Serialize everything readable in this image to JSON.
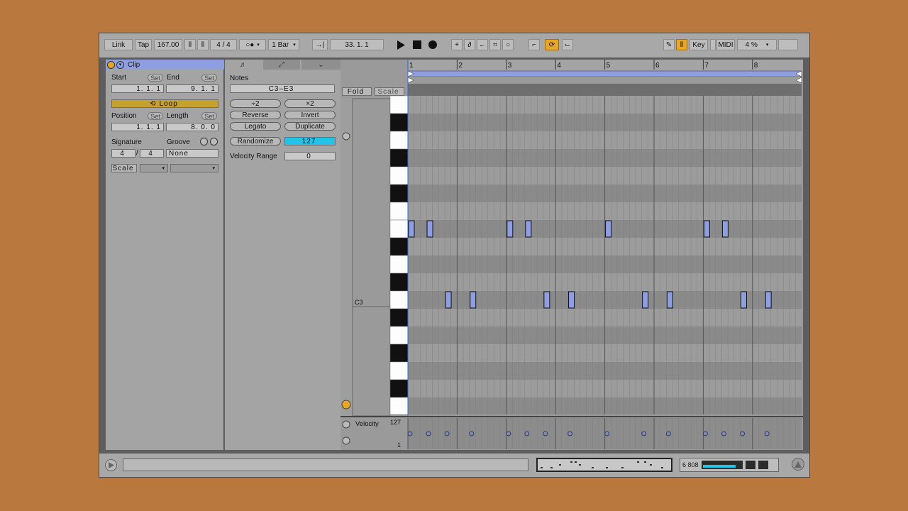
{
  "control_bar": {
    "link": "Link",
    "tap": "Tap",
    "tempo": "167.00",
    "time_signature": "4 / 4",
    "quantize": "1 Bar",
    "position": "33.  1.  1",
    "key": "Key",
    "midi": "MIDI",
    "cpu": "4 %"
  },
  "clip": {
    "title": "Clip",
    "start_label": "Start",
    "end_label": "End",
    "set_label": "Set",
    "start_value": "1.   1.   1",
    "end_value": "9.   1.   1",
    "loop_label": "Loop",
    "position_label": "Position",
    "length_label": "Length",
    "position_value": "1.   1.   1",
    "length_value": "8.   0.   0",
    "signature_label": "Signature",
    "groove_label": "Groove",
    "sig_num": "4",
    "sig_den": "4",
    "groove_value": "None",
    "scale_label": "Scale"
  },
  "notes": {
    "title": "Notes",
    "range": "C3–E3",
    "div2": "÷2",
    "mul2": "×2",
    "reverse": "Reverse",
    "invert": "Invert",
    "legato": "Legato",
    "duplicate": "Duplicate",
    "randomize": "Randomize",
    "randomize_value": "127",
    "velocity_range_label": "Velocity Range",
    "velocity_range_value": "0"
  },
  "editor": {
    "fold": "Fold",
    "scale": "Scale",
    "bar_labels": [
      "1",
      "2",
      "3",
      "4",
      "5",
      "6",
      "7",
      "8"
    ],
    "c3_label": "C3",
    "velocity_label": "Velocity",
    "vel_max": "127",
    "vel_min": "1",
    "notes": [
      {
        "beat": 0.0,
        "row": 7
      },
      {
        "beat": 1.5,
        "row": 7
      },
      {
        "beat": 3.0,
        "row": 11
      },
      {
        "beat": 5.0,
        "row": 11
      },
      {
        "beat": 8.0,
        "row": 7
      },
      {
        "beat": 9.5,
        "row": 7
      },
      {
        "beat": 11.0,
        "row": 11
      },
      {
        "beat": 13.0,
        "row": 11
      },
      {
        "beat": 16.0,
        "row": 7
      },
      {
        "beat": 19.0,
        "row": 11
      },
      {
        "beat": 21.0,
        "row": 11
      },
      {
        "beat": 24.0,
        "row": 7
      },
      {
        "beat": 25.5,
        "row": 7
      },
      {
        "beat": 27.0,
        "row": 11
      },
      {
        "beat": 29.0,
        "row": 11
      }
    ]
  },
  "status": {
    "cpu_text": "6 808"
  },
  "colors": {
    "accent": "#e8a628",
    "clip_header": "#8e9ee0",
    "randomize": "#22c3e6",
    "note_fill": "#8e9ee0",
    "loop_bar": "#8e9ee0"
  }
}
